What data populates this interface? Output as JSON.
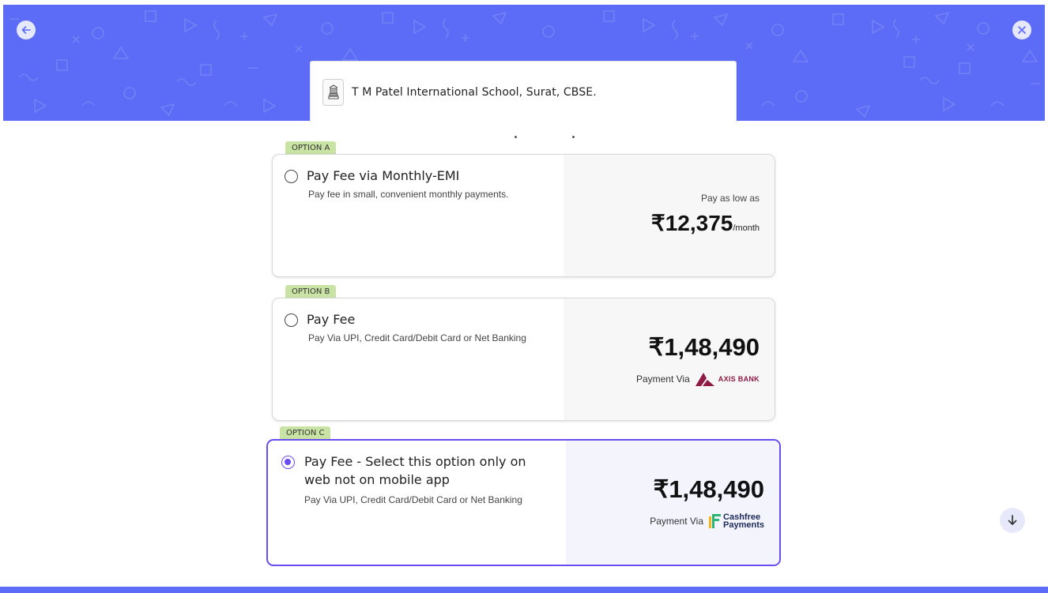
{
  "header": {
    "school_name": "T M Patel International School, Surat, CBSE."
  },
  "colors": {
    "brand": "#5c6cf6",
    "tag_green": "#c8e3a4",
    "selected_border": "#6a4cf0",
    "axis_bank": "#8d1b44"
  },
  "icons": {
    "back": "arrow-left-icon",
    "close": "close-icon",
    "school": "school-building-icon",
    "scroll_down": "arrow-down-icon"
  },
  "options": [
    {
      "tag": "OPTION A",
      "title": "Pay Fee via Monthly-EMI",
      "description": "Pay fee in small, convenient monthly payments.",
      "low_as": "Pay as low as",
      "price": "₹12,375",
      "unit": "/month",
      "selected": false
    },
    {
      "tag": "OPTION B",
      "title": "Pay Fee",
      "description": "Pay Via UPI, Credit Card/Debit Card or Net Banking",
      "price": "₹1,48,490",
      "payment_via": "Payment Via",
      "gateway": "AXIS BANK",
      "selected": false
    },
    {
      "tag": "OPTION C",
      "title_line1": "Pay Fee - Select this option only on",
      "title_line2": "web not on mobile app",
      "description": "Pay Via UPI, Credit Card/Debit Card or Net Banking",
      "price": "₹1,48,490",
      "payment_via": "Payment Via",
      "gateway_line1": "Cashfree",
      "gateway_line2": "Payments",
      "selected": true
    }
  ]
}
